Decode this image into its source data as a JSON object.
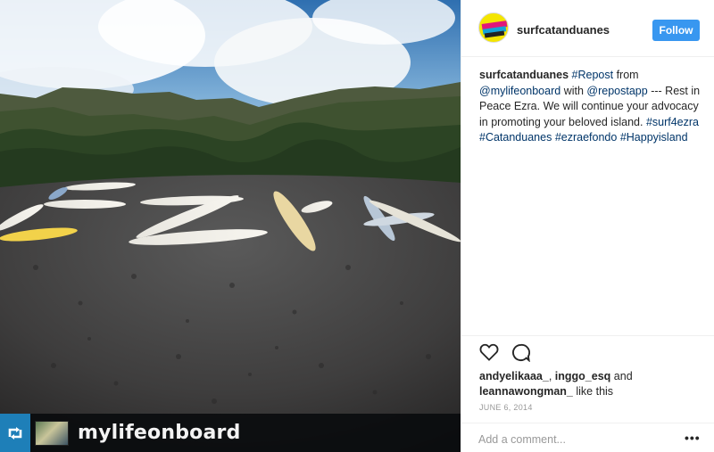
{
  "photo": {
    "repost_user": "mylifeonboard",
    "icon_name": "repost-icon"
  },
  "post": {
    "username": "surfcatanduanes",
    "follow_label": "Follow",
    "caption": {
      "user": "surfcatanduanes",
      "repost_tag": "#Repost",
      "text_from": "from",
      "mention_source": "@mylifeonboard",
      "text_with": "with",
      "mention_app": "@repostapp",
      "text_body": "--- Rest in Peace Ezra. We will continue your advocacy in promoting your beloved island.",
      "tags": [
        "#surf4ezra",
        "#Catanduanes",
        "#ezraefondo",
        "#Happyisland"
      ]
    },
    "likes": {
      "user1": "andyelikaaa_",
      "user2": "inggo_esq",
      "and": "and",
      "user3": "leannawongman_",
      "suffix": "like this"
    },
    "date": "JUNE 6, 2014",
    "comment_placeholder": "Add a comment...",
    "more_label": "•••"
  },
  "colors": {
    "accent": "#3897f0",
    "link": "#003569",
    "repost_blue": "#1e7fb8"
  }
}
